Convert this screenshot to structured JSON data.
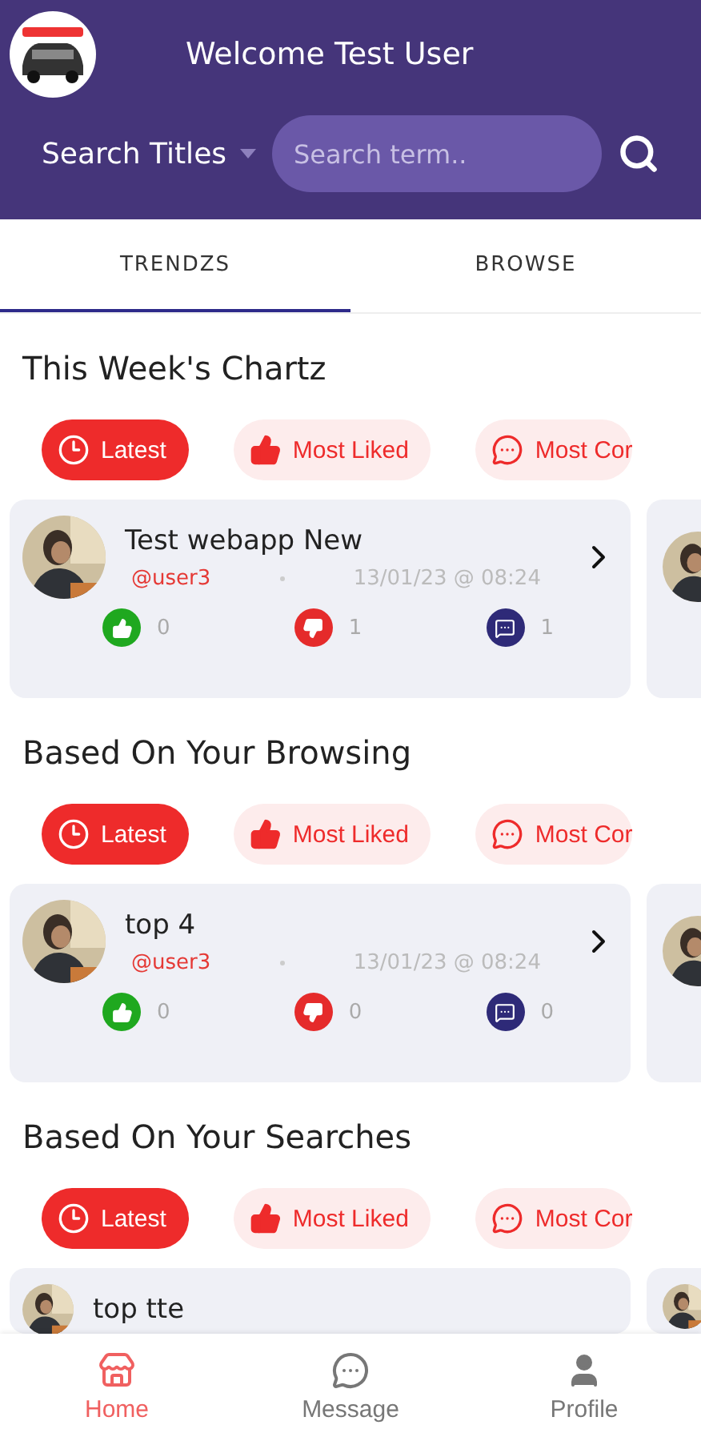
{
  "header": {
    "title": "Welcome Test User",
    "search_scope": "Search Titles",
    "search": {
      "placeholder": "Search term.."
    }
  },
  "tabs": [
    {
      "label": "TRENDZS",
      "selected": true
    },
    {
      "label": "BROWSE",
      "selected": false
    }
  ],
  "sections": [
    {
      "title": "This Week's Chartz",
      "filters": [
        {
          "label": "Latest",
          "kind": "latest",
          "selected": true
        },
        {
          "label": "Most Liked",
          "kind": "liked",
          "selected": false
        },
        {
          "label": "Most Cor",
          "kind": "commented",
          "selected": false
        }
      ],
      "cards": [
        {
          "kind": "post",
          "title": "Test webapp New",
          "user": "@user3",
          "date": "13/01/23 @ 08:24",
          "likes": "0",
          "dislikes": "1",
          "comments": "1"
        },
        {
          "kind": "peek"
        }
      ]
    },
    {
      "title": "Based On Your Browsing",
      "filters": [
        {
          "label": "Latest",
          "kind": "latest",
          "selected": true
        },
        {
          "label": "Most Liked",
          "kind": "liked",
          "selected": false
        },
        {
          "label": "Most Cor",
          "kind": "commented",
          "selected": false
        }
      ],
      "cards": [
        {
          "kind": "post",
          "title": "top 4",
          "user": "@user3",
          "date": "13/01/23 @ 08:24",
          "likes": "0",
          "dislikes": "0",
          "comments": "0"
        },
        {
          "kind": "peek"
        }
      ]
    },
    {
      "title": "Based On Your Searches",
      "filters": [
        {
          "label": "Latest",
          "kind": "latest",
          "selected": true
        },
        {
          "label": "Most Liked",
          "kind": "liked",
          "selected": false
        },
        {
          "label": "Most Cor",
          "kind": "commented",
          "selected": false
        }
      ],
      "cards": [
        {
          "kind": "post",
          "title": "top tte"
        },
        {
          "kind": "peek"
        }
      ]
    }
  ],
  "nav": [
    {
      "label": "Home",
      "kind": "home",
      "selected": true
    },
    {
      "label": "Message",
      "kind": "message",
      "selected": false
    },
    {
      "label": "Profile",
      "kind": "profile",
      "selected": false
    }
  ]
}
